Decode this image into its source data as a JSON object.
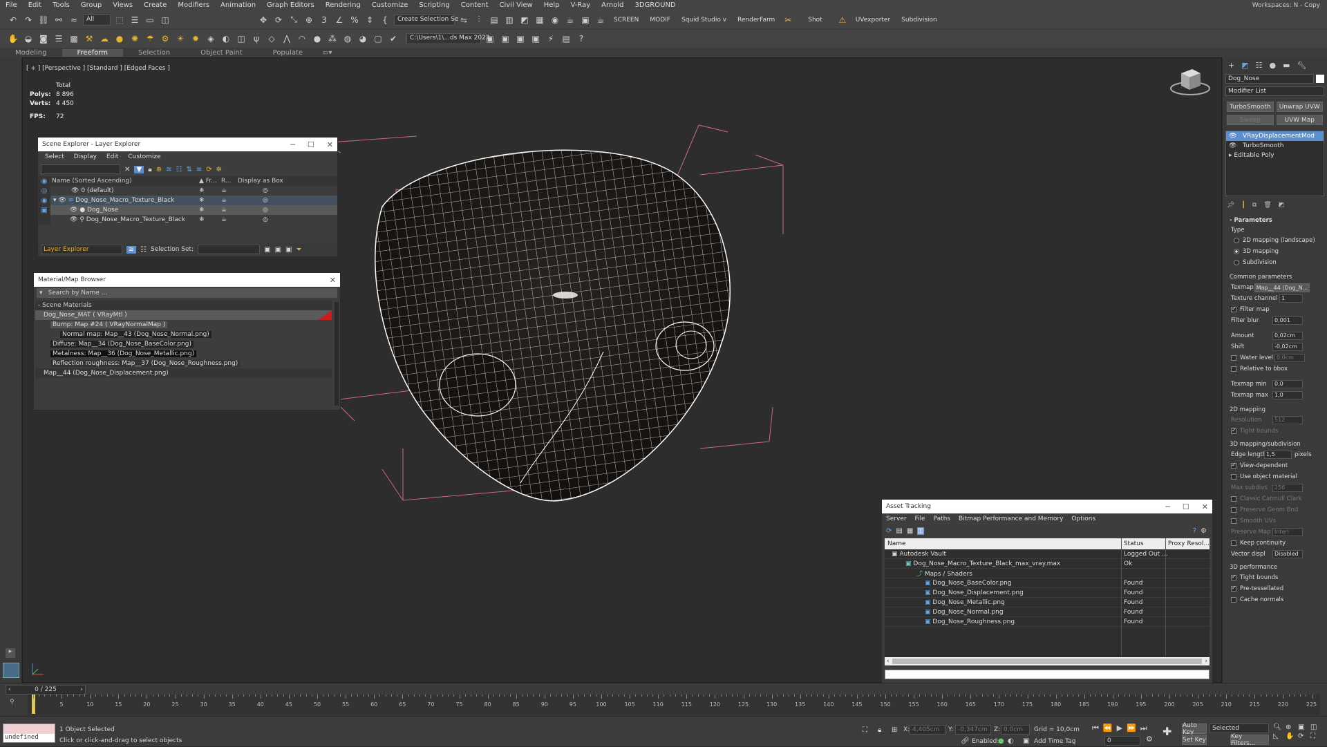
{
  "menu": [
    "File",
    "Edit",
    "Tools",
    "Group",
    "Views",
    "Create",
    "Modifiers",
    "Animation",
    "Graph Editors",
    "Rendering",
    "Customize",
    "Scripting",
    "Content",
    "Civil View",
    "Help",
    "V-Ray",
    "Arnold",
    "3DGROUND"
  ],
  "workspace": "Workspaces:  N - Copy",
  "toolbar": {
    "filter": "All",
    "selection_set": "Create Selection Se",
    "screen": "SCREEN",
    "modif": "MODIF",
    "squid": "Squid Studio v",
    "renderfarm": "RenderFarm",
    "shot": "Shot",
    "uvexporter": "UVexporter",
    "subdivision": "Subdivision",
    "path": "C:\\Users\\1\\...ds Max 2022"
  },
  "ribbon_tabs": [
    "Modeling",
    "Freeform",
    "Selection",
    "Object Paint",
    "Populate"
  ],
  "viewport": {
    "label": "[ + ] [Perspective ] [Standard ] [Edged Faces ]",
    "stats": {
      "total": "Total",
      "polys_label": "Polys:",
      "polys": "8 896",
      "verts_label": "Verts:",
      "verts": "4 450",
      "fps_label": "FPS:",
      "fps": "72"
    }
  },
  "scene_explorer": {
    "title": "Scene Explorer - Layer Explorer",
    "menu": [
      "Select",
      "Display",
      "Edit",
      "Customize"
    ],
    "col_name": "Name (Sorted Ascending)",
    "col_fr": "▲ Fr...",
    "col_r": "R...",
    "col_box": "Display as Box",
    "rows": [
      "0 (default)",
      "Dog_Nose_Macro_Texture_Black",
      "Dog_Nose",
      "Dog_Nose_Macro_Texture_Black"
    ],
    "footer_layer": "Layer Explorer",
    "footer_selset": "Selection Set:"
  },
  "material_browser": {
    "title": "Material/Map Browser",
    "search": "Search by Name ...",
    "section": "- Scene Materials",
    "items": [
      "Dog_Nose_MAT  ( VRayMtl )",
      "Bump: Map #24  ( VRayNormalMap )",
      "Normal map: Map__43 (Dog_Nose_Normal.png)",
      "Diffuse: Map__34 (Dog_Nose_BaseColor.png)",
      "Metalness: Map__36 (Dog_Nose_Metallic.png)",
      "Reflection roughness: Map__37 (Dog_Nose_Roughness.png)",
      "Map__44 (Dog_Nose_Displacement.png)"
    ]
  },
  "asset_tracking": {
    "title": "Asset Tracking",
    "menu": [
      "Server",
      "File",
      "Paths",
      "Bitmap Performance and Memory",
      "Options"
    ],
    "cols": [
      "Name",
      "Status",
      "Proxy Resol..."
    ],
    "rows": [
      {
        "name": "Autodesk Vault",
        "status": "Logged Out ..."
      },
      {
        "name": "Dog_Nose_Macro_Texture_Black_max_vray.max",
        "status": "Ok"
      },
      {
        "name": "Maps / Shaders",
        "status": ""
      },
      {
        "name": "Dog_Nose_BaseColor.png",
        "status": "Found"
      },
      {
        "name": "Dog_Nose_Displacement.png",
        "status": "Found"
      },
      {
        "name": "Dog_Nose_Metallic.png",
        "status": "Found"
      },
      {
        "name": "Dog_Nose_Normal.png",
        "status": "Found"
      },
      {
        "name": "Dog_Nose_Roughness.png",
        "status": "Found"
      }
    ]
  },
  "command_panel": {
    "object_name": "Dog_Nose",
    "modifier_list": "Modifier List",
    "buttons": [
      "TurboSmooth",
      "Unwrap UVW",
      "Sweep",
      "UVW Map"
    ],
    "stack": [
      "VRayDisplacementMod",
      "TurboSmooth",
      "Editable Poly"
    ],
    "params_title": "Parameters",
    "type_label": "Type",
    "types": [
      "2D mapping (landscape)",
      "3D mapping",
      "Subdivision"
    ],
    "common": "Common parameters",
    "texmap_label": "Texmap",
    "texmap": "Map__44 (Dog_N...",
    "texture_channel_label": "Texture channel",
    "texture_channel": "1",
    "filter_map": "Filter map",
    "filter_blur_label": "Filter blur",
    "filter_blur": "0,001",
    "amount_label": "Amount",
    "amount": "0,02cm",
    "shift_label": "Shift",
    "shift": "-0,02cm",
    "water_level": "Water level",
    "water_level_val": "0,0cm",
    "relative_bbox": "Relative to bbox",
    "texmap_min_label": "Texmap min",
    "texmap_min": "0,0",
    "texmap_max_label": "Texmap max",
    "texmap_max": "1,0",
    "mapping2d": "2D mapping",
    "resolution_label": "Resolution",
    "resolution": "512",
    "tight_bounds": "Tight bounds",
    "mapping3d": "3D mapping/subdivision",
    "edge_length_label": "Edge length",
    "edge_length": "1,5",
    "pixels": "pixels",
    "view_dependent": "View-dependent",
    "use_object_material": "Use object material",
    "max_subdivs_label": "Max subdivs",
    "max_subdivs": "256",
    "classic_catmull": "Classic Catmull Clark",
    "preserve_geom": "Preserve Geom Bnd",
    "smooth_uvs": "Smooth UVs",
    "preserve_map_label": "Preserve Map Bnd",
    "preserve_map": "Interi",
    "keep_continuity": "Keep continuity",
    "vector_displ_label": "Vector displ",
    "vector_displ": "Disabled",
    "performance": "3D performance",
    "tight_bounds2": "Tight bounds",
    "pre_tessellated": "Pre-tessellated",
    "cache_normals": "Cache normals"
  },
  "timeline": {
    "frame": "0 / 225",
    "ticks": [
      "0",
      "5",
      "10",
      "15",
      "20",
      "25",
      "30",
      "35",
      "40",
      "45",
      "50",
      "55",
      "60",
      "65",
      "70",
      "75",
      "80",
      "85",
      "90",
      "95",
      "100",
      "105",
      "110",
      "115",
      "120",
      "125",
      "130",
      "135",
      "140",
      "145",
      "150",
      "155",
      "160",
      "165",
      "170",
      "175",
      "180",
      "185",
      "190",
      "195",
      "200",
      "205",
      "210",
      "215",
      "220",
      "225"
    ]
  },
  "status": {
    "maxscript": "undefined",
    "selected": "1 Object Selected",
    "hint": "Click or click-and-drag to select objects",
    "x_label": "X:",
    "x": "4,405cm",
    "y_label": "Y:",
    "y": "-0,347cm",
    "z_label": "Z:",
    "z": "0,0cm",
    "grid": "Grid = 10,0cm",
    "enabled": "Enabled:",
    "add_time_tag": "Add Time Tag",
    "auto_key": "Auto Key",
    "set_key": "Set Key",
    "selected_dd": "Selected",
    "key_filters": "Key Filters...",
    "frame_val": "0"
  }
}
